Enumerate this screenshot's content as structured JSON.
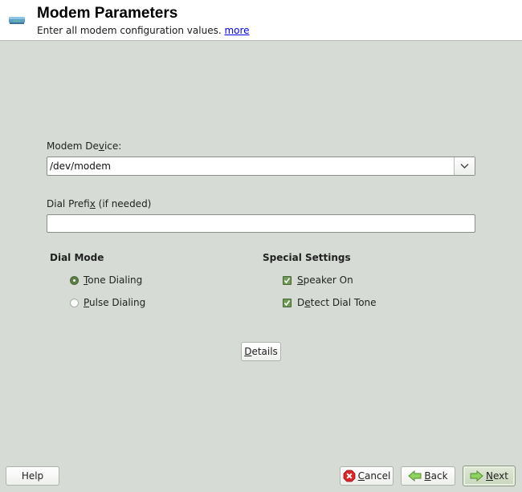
{
  "header": {
    "title": "Modem Parameters",
    "subtitle": "Enter all modem configuration values.",
    "more_link": "more",
    "icon": "modem-icon"
  },
  "form": {
    "modem_device": {
      "label_pre": "Modem De",
      "label_accel": "v",
      "label_post": "ice:",
      "value": "/dev/modem"
    },
    "dial_prefix": {
      "label_pre": "Dial Prefi",
      "label_accel": "x",
      "label_post": " (if needed)",
      "value": ""
    }
  },
  "dial_mode": {
    "title": "Dial Mode",
    "options": [
      {
        "accel": "T",
        "rest": "one Dialing",
        "selected": true
      },
      {
        "accel": "P",
        "rest": "ulse Dialing",
        "selected": false
      }
    ]
  },
  "special_settings": {
    "title": "Special Settings",
    "options": [
      {
        "pre": "",
        "accel": "S",
        "rest": "peaker On",
        "checked": true
      },
      {
        "pre": "D",
        "accel": "e",
        "rest": "tect Dial Tone",
        "checked": true
      }
    ]
  },
  "buttons": {
    "details": {
      "accel": "D",
      "rest": "etails"
    },
    "help": "Help",
    "cancel": {
      "accel": "C",
      "rest": "ancel"
    },
    "back": {
      "accel": "B",
      "rest": "ack"
    },
    "next": {
      "accel": "N",
      "rest": "ext"
    }
  }
}
